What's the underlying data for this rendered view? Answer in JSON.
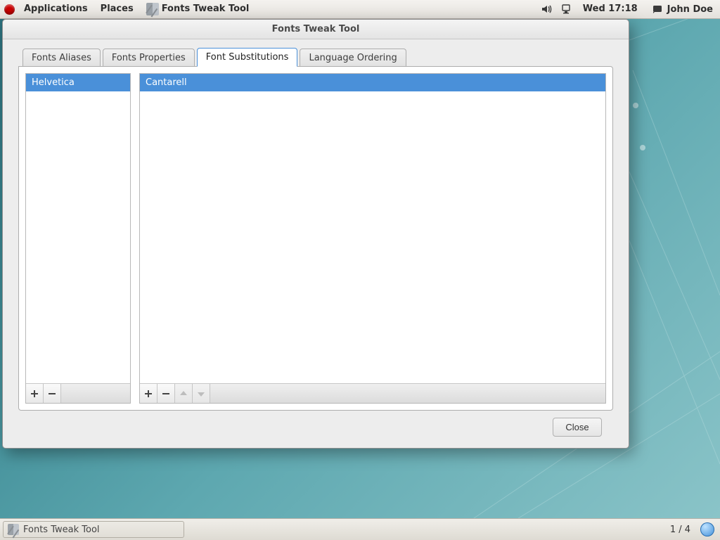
{
  "panel": {
    "apps": "Applications",
    "places": "Places",
    "active_task": "Fonts Tweak Tool",
    "clock": "Wed 17:18",
    "user": "John Doe"
  },
  "window": {
    "title": "Fonts Tweak Tool",
    "tabs": [
      "Fonts Aliases",
      "Fonts Properties",
      "Font Substitutions",
      "Language Ordering"
    ],
    "active_tab": 2,
    "left_items": [
      "Helvetica"
    ],
    "right_items": [
      "Cantarell"
    ],
    "close": "Close"
  },
  "taskbar": {
    "task": "Fonts Tweak Tool",
    "workspaces": "1 / 4"
  }
}
